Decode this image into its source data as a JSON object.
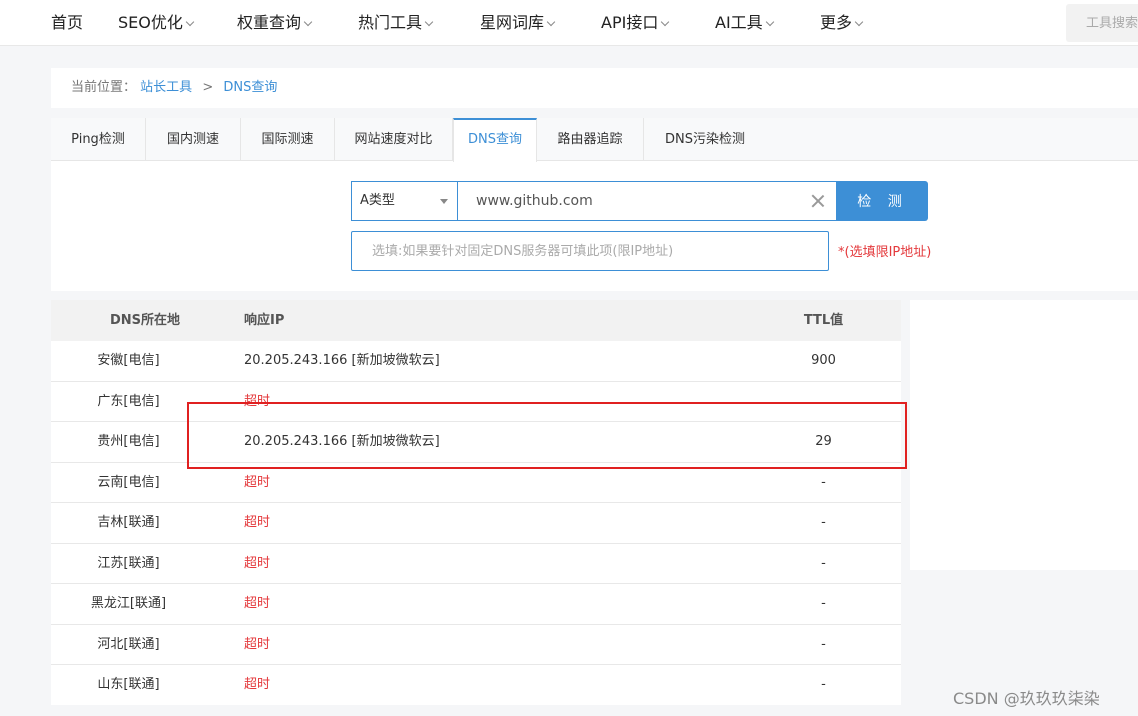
{
  "nav": {
    "items": [
      {
        "label": "首页",
        "dropdown": false
      },
      {
        "label": "SEO优化",
        "dropdown": true
      },
      {
        "label": "权重查询",
        "dropdown": true
      },
      {
        "label": "热门工具",
        "dropdown": true
      },
      {
        "label": "星网词库",
        "dropdown": true
      },
      {
        "label": "API接口",
        "dropdown": true
      },
      {
        "label": "AI工具",
        "dropdown": true
      },
      {
        "label": "更多",
        "dropdown": true
      }
    ],
    "search_placeholder": "工具搜索"
  },
  "breadcrumb": {
    "prefix": "当前位置：",
    "items": [
      "站长工具",
      "DNS查询"
    ],
    "separator": ">"
  },
  "tabs": [
    {
      "label": "Ping检测",
      "active": false
    },
    {
      "label": "国内测速",
      "active": false
    },
    {
      "label": "国际测速",
      "active": false
    },
    {
      "label": "网站速度对比",
      "active": false
    },
    {
      "label": "DNS查询",
      "active": true
    },
    {
      "label": "路由器追踪",
      "active": false
    },
    {
      "label": "DNS污染检测",
      "active": false
    }
  ],
  "query": {
    "type_value": "A类型",
    "domain_value": "www.github.com",
    "detect_label": "检 测",
    "server_placeholder": "选填:如果要针对固定DNS服务器可填此项(限IP地址)",
    "hint": "*(选填限IP地址)"
  },
  "results": {
    "headers": {
      "location": "DNS所在地",
      "ip": "响应IP",
      "ttl": "TTL值"
    },
    "rows": [
      {
        "location": "安徽[电信]",
        "ip": "20.205.243.166 [新加坡微软云]",
        "ttl": "900",
        "timeout": false
      },
      {
        "location": "广东[电信]",
        "ip": "超时",
        "ttl": "",
        "timeout": true
      },
      {
        "location": "贵州[电信]",
        "ip": "20.205.243.166 [新加坡微软云]",
        "ttl": "29",
        "timeout": false
      },
      {
        "location": "云南[电信]",
        "ip": "超时",
        "ttl": "-",
        "timeout": true
      },
      {
        "location": "吉林[联通]",
        "ip": "超时",
        "ttl": "-",
        "timeout": true
      },
      {
        "location": "江苏[联通]",
        "ip": "超时",
        "ttl": "-",
        "timeout": true
      },
      {
        "location": "黑龙江[联通]",
        "ip": "超时",
        "ttl": "-",
        "timeout": true
      },
      {
        "location": "河北[联通]",
        "ip": "超时",
        "ttl": "-",
        "timeout": true
      },
      {
        "location": "山东[联通]",
        "ip": "超时",
        "ttl": "-",
        "timeout": true
      }
    ]
  },
  "watermark": "CSDN @玖玖玖柒染",
  "colors": {
    "accent": "#3d8fd6",
    "timeout": "#e4393c",
    "highlight": "#e02020"
  }
}
